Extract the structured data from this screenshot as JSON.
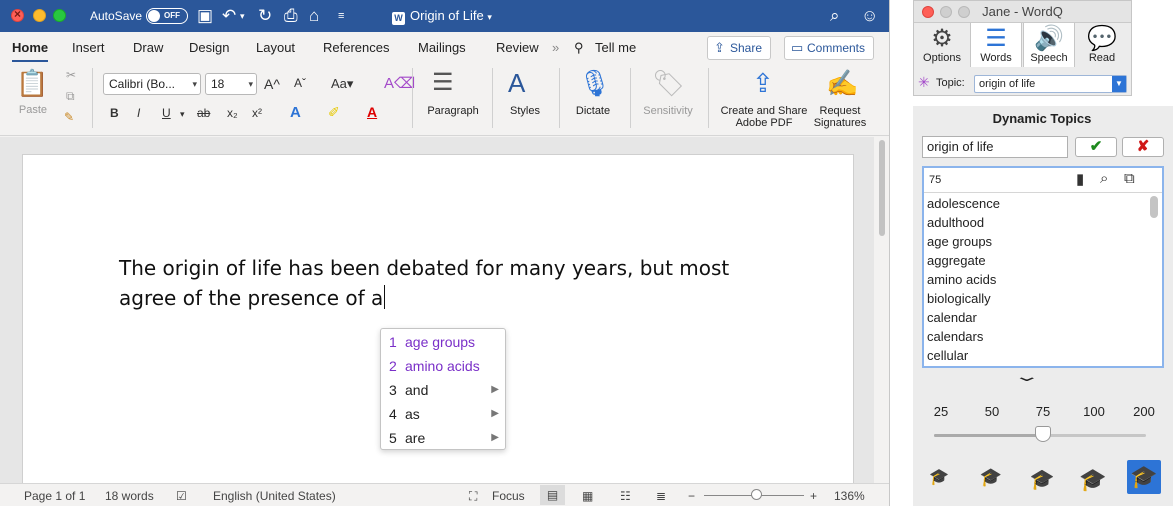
{
  "word": {
    "autosave_label": "AutoSave",
    "autosave_state": "OFF",
    "doc_title": "Origin of Life",
    "tabs": [
      "Home",
      "Insert",
      "Draw",
      "Design",
      "Layout",
      "References",
      "Mailings",
      "Review"
    ],
    "tell_me": "Tell me",
    "share_label": "Share",
    "comments_label": "Comments",
    "ribbon": {
      "paste": "Paste",
      "font_name": "Calibri (Bo...",
      "font_size": "18",
      "paragraph": "Paragraph",
      "styles": "Styles",
      "dictate": "Dictate",
      "sensitivity": "Sensitivity",
      "create_share_pdf_line1": "Create and Share",
      "create_share_pdf_line2": "Adobe PDF",
      "request_sig_line1": "Request",
      "request_sig_line2": "Signatures"
    },
    "document_text_line1": "The origin of life has been debated for many years, but most",
    "document_text_line2": "agree of the presence of a",
    "predictions": [
      {
        "num": "1",
        "word": "age groups"
      },
      {
        "num": "2",
        "word": "amino acids"
      },
      {
        "num": "3",
        "word": "and"
      },
      {
        "num": "4",
        "word": "as"
      },
      {
        "num": "5",
        "word": "are"
      }
    ],
    "status": {
      "page": "Page 1 of 1",
      "words": "18 words",
      "language": "English (United States)",
      "focus": "Focus",
      "zoom": "136%",
      "zoom_fraction": 0.47
    }
  },
  "wordq": {
    "title": "Jane - WordQ",
    "tools": [
      "Options",
      "Words",
      "Speech",
      "Read"
    ],
    "topic_label": "Topic:",
    "topic_value": "origin of life",
    "dynamic_title": "Dynamic Topics",
    "input_value": "origin of life",
    "count": "75",
    "words": [
      "adolescence",
      "adulthood",
      "age groups",
      "aggregate",
      "amino acids",
      "biologically",
      "calendar",
      "calendars",
      "cellular"
    ],
    "slider_ticks": [
      "25",
      "50",
      "75",
      "100",
      "200"
    ],
    "slider_value": 75
  },
  "colors": {
    "word_blue": "#2b579a",
    "prediction_purple": "#7a2fc8",
    "wordq_accent": "#2d74d6"
  }
}
